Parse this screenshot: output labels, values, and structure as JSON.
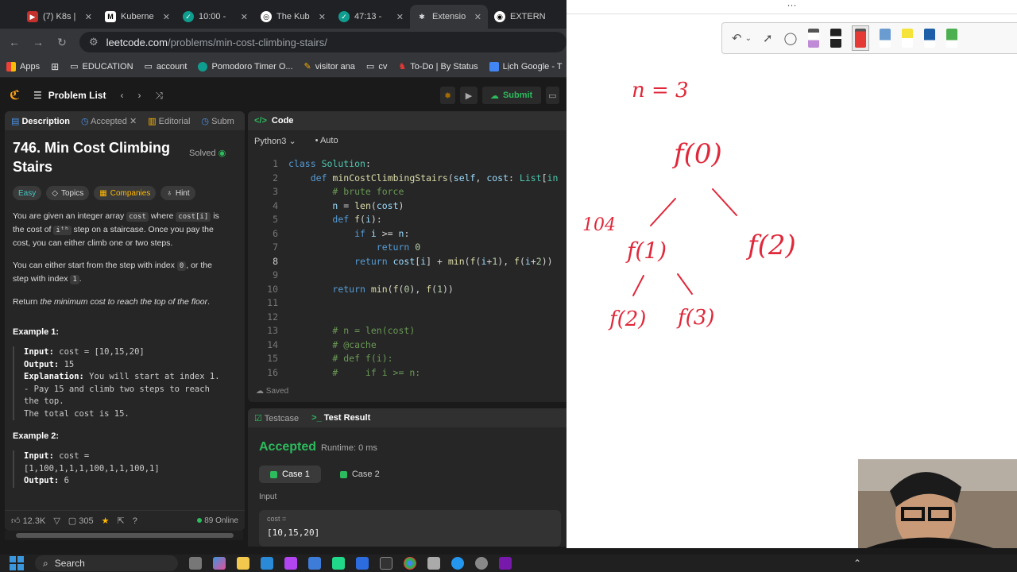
{
  "browser": {
    "tabs": [
      {
        "label": "(7) K8s |",
        "icon": "K8s",
        "icon_color": "#c4302b"
      },
      {
        "label": "Kuberne",
        "icon": "Mk",
        "icon_color": "#444"
      },
      {
        "label": "10:00 -",
        "icon": "✓",
        "icon_color": "#0f9d8f"
      },
      {
        "label": "The Kub",
        "icon": "◎",
        "icon_color": "#666"
      },
      {
        "label": "47:13 -",
        "icon": "✓",
        "icon_color": "#0f9d8f"
      },
      {
        "label": "Extensio",
        "icon": "✱",
        "icon_color": "#555"
      },
      {
        "label": "EXTERN",
        "icon": "◉",
        "icon_color": "#666"
      }
    ],
    "url_host": "leetcode.com",
    "url_path": "/problems/min-cost-climbing-stairs/",
    "bookmarks": [
      "Apps",
      "EDUCATION",
      "account",
      "Pomodoro Timer O...",
      "visitor ana",
      "cv",
      "To-Do | By Status",
      "Lịch Google - T"
    ]
  },
  "leetcode": {
    "problem_list": "Problem List",
    "submit": "Submit",
    "left_tabs": [
      "Description",
      "Accepted",
      "Editorial",
      "Subm"
    ],
    "title": "746. Min Cost Climbing Stairs",
    "solved": "Solved",
    "tags": [
      "Easy",
      "Topics",
      "Companies",
      "Hint"
    ],
    "desc1_a": "You are given an integer array ",
    "desc1_code1": "cost",
    "desc1_b": " where ",
    "desc1_code2": "cost[i]",
    "desc1_c": " is the cost of ",
    "desc1_code3": "iᵗʰ",
    "desc1_d": " step on a staircase. Once you pay the cost, you can either climb one or two steps.",
    "desc2_a": "You can either start from the step with index ",
    "desc2_code1": "0",
    "desc2_b": ", or the step with index ",
    "desc2_code2": "1",
    "desc2_c": ".",
    "desc3_a": "Return ",
    "desc3_b": "the minimum cost to reach the top of the floor",
    "desc3_c": ".",
    "ex1_title": "Example 1:",
    "ex1_input_k": "Input:",
    "ex1_input_v": " cost = [10,15,20]",
    "ex1_output_k": "Output:",
    "ex1_output_v": " 15",
    "ex1_expl_k": "Explanation:",
    "ex1_expl_v": " You will start at index 1.",
    "ex1_l2": "- Pay 15 and climb two steps to reach",
    "ex1_l3": "the top.",
    "ex1_l4": "The total cost is 15.",
    "ex2_title": "Example 2:",
    "ex2_input_k": "Input:",
    "ex2_input_v": " cost =",
    "ex2_l2": "[1,100,1,1,1,100,1,1,100,1]",
    "ex2_output_k": "Output:",
    "ex2_output_v": " 6",
    "likes": "12.3K",
    "comments": "305",
    "online": "89 Online",
    "code_title": "Code",
    "language": "Python3",
    "auto": "Auto",
    "code_lines": [
      "1",
      "2",
      "3",
      "4",
      "5",
      "6",
      "7",
      "8",
      "9",
      "10",
      "11",
      "12",
      "13",
      "14",
      "15",
      "16"
    ],
    "saved": "Saved",
    "test_tabs": [
      "Testcase",
      "Test Result"
    ],
    "accepted": "Accepted",
    "runtime": "Runtime: 0 ms",
    "cases": [
      "Case 1",
      "Case 2"
    ],
    "input_label": "Input",
    "input_key": "cost =",
    "input_value": "[10,15,20]"
  },
  "whiteboard": {
    "dots": "···",
    "notes": [
      "n = 3",
      "f(0)",
      "f(1)",
      "f(2)",
      "f(2)",
      "f(3)",
      "104"
    ]
  },
  "taskbar": {
    "search": "Search"
  }
}
